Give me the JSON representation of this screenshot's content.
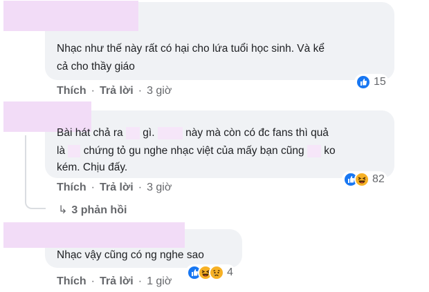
{
  "comments": [
    {
      "lines": [
        "Nhạc như thế này rất có hại cho lứa tuổi học sinh. Và kể",
        "cả cho thầy giáo"
      ],
      "like_label": "Thích",
      "reply_label": "Trả lời",
      "time": "3 giờ",
      "reaction_count": "15",
      "reactions": [
        "like-reaction-icon"
      ]
    },
    {
      "lines": [
        "Bài hát chả ra",
        "gì.",
        "này mà còn có đc fans thì quả",
        "là",
        "chứng tỏ gu nghe nhạc việt của mấy bạn cũng",
        "ko",
        "kém. Chịu đấy."
      ],
      "like_label": "Thích",
      "reply_label": "Trả lời",
      "time": "3 giờ",
      "reaction_count": "82",
      "reactions": [
        "like-reaction-icon",
        "haha-reaction-icon"
      ],
      "replies_label": "3 phản hồi"
    },
    {
      "lines": [
        "Nhạc vậy cũng có ng nghe sao"
      ],
      "like_label": "Thích",
      "reply_label": "Trả lời",
      "time": "1 giờ",
      "reaction_count": "4",
      "reactions": [
        "like-reaction-icon",
        "haha-reaction-icon",
        "sad-reaction-icon"
      ]
    }
  ],
  "colors": {
    "bubble": "#f0f2f5",
    "like_blue": "#1877f2",
    "emoji_yellow": "#f7b125",
    "redaction": "#f2dcf7",
    "meta_gray": "#65676b"
  }
}
